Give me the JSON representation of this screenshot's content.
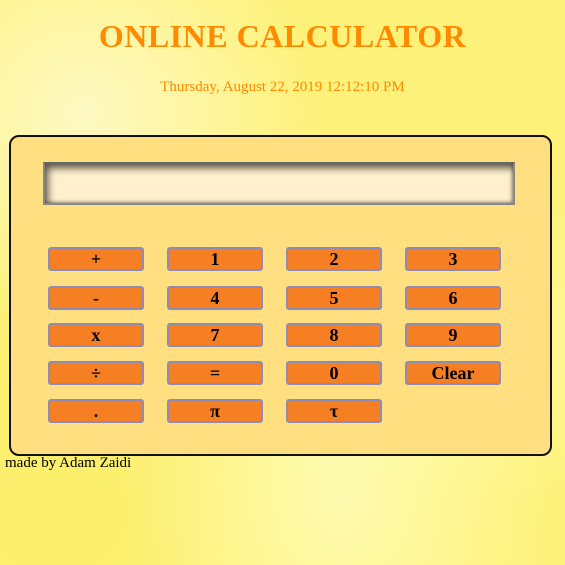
{
  "header": {
    "title": "ONLINE CALCULATOR",
    "datetime": "Thursday, August 22, 2019 12:12:10 PM"
  },
  "calculator": {
    "display_value": "",
    "keys": {
      "plus": "+",
      "one": "1",
      "two": "2",
      "three": "3",
      "minus": "-",
      "four": "4",
      "five": "5",
      "six": "6",
      "multiply": "x",
      "seven": "7",
      "eight": "8",
      "nine": "9",
      "divide": "÷",
      "equals": "=",
      "zero": "0",
      "clear": "Clear",
      "decimal": ".",
      "pi": "π",
      "tau": "τ"
    }
  },
  "footer": {
    "credit": "made by Adam Zaidi"
  },
  "colors": {
    "title": "#ff8a00",
    "panel": "#ffdf80",
    "key": "#f57f22",
    "display": "#ffefcc"
  }
}
